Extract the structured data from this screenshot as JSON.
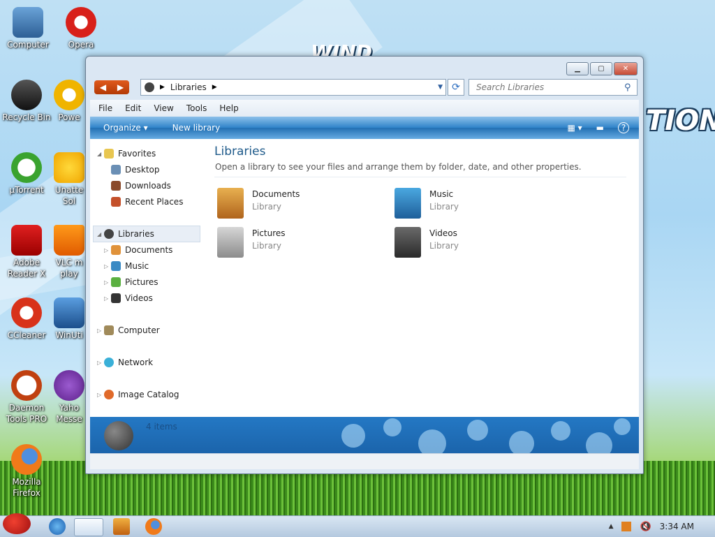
{
  "desktop": {
    "icons": [
      {
        "label": "Computer"
      },
      {
        "label": "Opera"
      },
      {
        "label": "Recycle Bin"
      },
      {
        "label": "Powe"
      },
      {
        "label": "µTorrent"
      },
      {
        "label": "Unatte Sol"
      },
      {
        "label": "Adobe Reader X"
      },
      {
        "label": "VLC m play"
      },
      {
        "label": "CCleaner"
      },
      {
        "label": "WinUti"
      },
      {
        "label": "Daemon Tools PRO"
      },
      {
        "label": "Yaho Messe"
      },
      {
        "label": "Mozilla Firefox"
      }
    ],
    "wallpaper_text": [
      "WIND",
      "TION"
    ]
  },
  "window": {
    "address": {
      "crumb": "Libraries"
    },
    "search": {
      "placeholder": "Search Libraries"
    },
    "menu": [
      "File",
      "Edit",
      "View",
      "Tools",
      "Help"
    ],
    "toolbar": {
      "organize": "Organize",
      "new_library": "New library"
    },
    "nav": {
      "favorites": "Favorites",
      "desktop": "Desktop",
      "downloads": "Downloads",
      "recent": "Recent Places",
      "libraries": "Libraries",
      "documents": "Documents",
      "music": "Music",
      "pictures": "Pictures",
      "videos": "Videos",
      "computer": "Computer",
      "network": "Network",
      "image_catalog": "Image Catalog"
    },
    "content": {
      "title": "Libraries",
      "subtitle": "Open a library to see your files and arrange them by folder, date, and other properties.",
      "libraries": [
        {
          "name": "Documents",
          "type": "Library"
        },
        {
          "name": "Music",
          "type": "Library"
        },
        {
          "name": "Pictures",
          "type": "Library"
        },
        {
          "name": "Videos",
          "type": "Library"
        }
      ]
    },
    "details": {
      "count": "4 items"
    }
  },
  "taskbar": {
    "clock": "3:34 AM"
  },
  "colors": {
    "accent": "#2f83c9",
    "title": "#1e5a8a"
  }
}
